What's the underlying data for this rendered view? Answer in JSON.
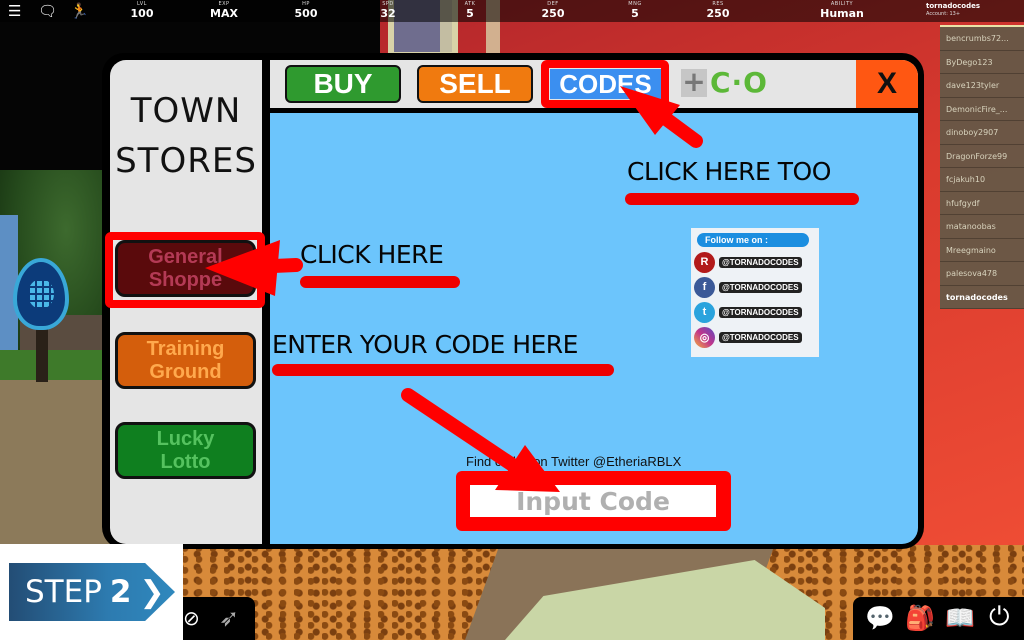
{
  "hud": {
    "icons": [
      "menu-icon",
      "chat-icon",
      "emote-icon"
    ],
    "stats": [
      {
        "key": "LVL",
        "value": "100"
      },
      {
        "key": "EXP",
        "value": "MAX"
      },
      {
        "key": "HP",
        "value": "500"
      },
      {
        "key": "SPD",
        "value": "32"
      },
      {
        "key": "ATK",
        "value": "5"
      },
      {
        "key": "DEF",
        "value": "250"
      },
      {
        "key": "MNG",
        "value": "5"
      },
      {
        "key": "RES",
        "value": "250"
      },
      {
        "key": "ABILITY",
        "value": "Human"
      }
    ],
    "account": {
      "name": "tornadocodes",
      "label": "Account: 13+"
    }
  },
  "players": [
    "bencrumbs72...",
    "ByDego123",
    "dave123tyler",
    "DemonicFire_...",
    "dinoboy2907",
    "DragonForze99",
    "fcjakuh10",
    "hfufgydf",
    "matanoobas",
    "Mreegmaino",
    "palesova478",
    "tornadocodes"
  ],
  "store": {
    "title_line1": "TOWN",
    "title_line2": "STORES",
    "side_buttons": [
      {
        "line1": "General",
        "line2": "Shoppe"
      },
      {
        "line1": "Training",
        "line2": "Ground"
      },
      {
        "line1": "Lucky",
        "line2": "Lotto"
      }
    ],
    "tabs": {
      "buy": "BUY",
      "sell": "SELL",
      "codes": "CODES"
    },
    "plus_glyph": "+",
    "co_glyph": "C·O",
    "close": "X",
    "social": {
      "header": "Follow me on :",
      "rows": [
        {
          "network": "roblox",
          "icon": "R",
          "handle": "@TORNADOCODES",
          "color": "#b21a1a"
        },
        {
          "network": "facebook",
          "icon": "f",
          "handle": "@TORNADOCODES",
          "color": "#3b5998"
        },
        {
          "network": "twitter",
          "icon": "t",
          "handle": "@TORNADOCODES",
          "color": "#2aa3dd"
        },
        {
          "network": "instagram",
          "icon": "◎",
          "handle": "@TORNADOCODES",
          "color": "#c1358a"
        }
      ]
    },
    "twitter_note": "Find codes on Twitter @EtheriaRBLX",
    "code_input_placeholder": "Input Code"
  },
  "annotations": {
    "click_here": "CLICK HERE",
    "click_here_too": "CLICK HERE TOO",
    "enter_code": "ENTER YOUR CODE HERE",
    "accent_color": "#ee0000"
  },
  "step": {
    "label": "STEP",
    "number": "2",
    "chevron": "❯"
  },
  "toolbar": {
    "left_icons": [
      "hide-ui-icon",
      "speed-icon"
    ],
    "right_icons": [
      "chat-bubble-icon",
      "backpack-icon",
      "book-icon",
      "power-icon"
    ]
  }
}
